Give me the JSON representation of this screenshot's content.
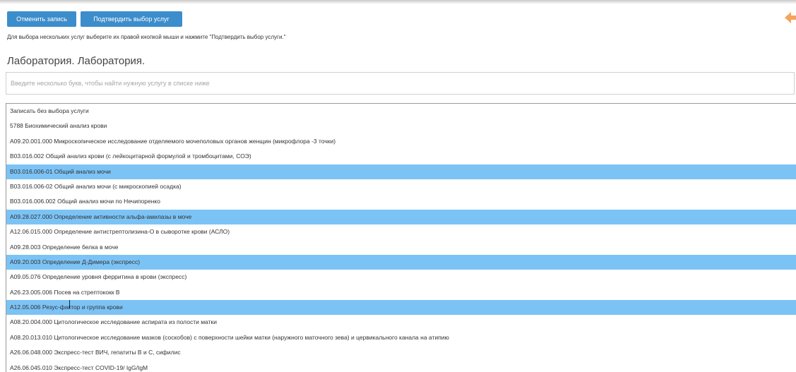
{
  "toolbar": {
    "cancel_label": "Отменить запись",
    "confirm_label": "Подтвердить выбор услуг"
  },
  "hint": "Для выбора нескольких услуг выберите их правой кнопкой мыши и нажмите \"Подтвердить выбор услуги.\"",
  "section_title": "Лаборатория. Лаборатория.",
  "search": {
    "placeholder": "Введите несколько букв, чтобы найти нужную услугу в списке ниже",
    "value": ""
  },
  "colors": {
    "button": "#3c8dcb",
    "selected_row": "#7cc3f5",
    "back_arrow": "#f5a45d"
  },
  "icons": {
    "back": "arrow-left-icon"
  },
  "services": [
    {
      "label": "Записать без выбора услуги",
      "selected": false
    },
    {
      "label": "5788 Биохимический анализ крови",
      "selected": false
    },
    {
      "label": "A09.20.001.000 Микроскопическое исследование отделяемого мочеполовых органов женщин (микрофлора -3 точки)",
      "selected": false
    },
    {
      "label": "B03.016.002 Общий анализ крови (с лейкоцитарной формулой и тромбоцитами, СОЭ)",
      "selected": false
    },
    {
      "label": "B03.016.006-01 Общий анализ мочи",
      "selected": true
    },
    {
      "label": "B03.016.006-02 Общий анализ мочи (с микроскопией осадка)",
      "selected": false
    },
    {
      "label": "B03.016.006.002 Общий анализ мочи по Нечипоренко",
      "selected": false
    },
    {
      "label": "A09.28.027.000 Определение активности альфа-амилазы в моче",
      "selected": true
    },
    {
      "label": "A12.06.015.000 Определение антистрептолизина-О в сыворотке крови (АСЛО)",
      "selected": false
    },
    {
      "label": "A09.28.003 Определение белка в моче",
      "selected": false
    },
    {
      "label": "A09.20.003 Определение Д-Димера (экспресс)",
      "selected": true
    },
    {
      "label": "A09.05.076 Определение уровня ферритина в крови (экспресс)",
      "selected": false
    },
    {
      "label": "A26.23.005.006 Посев на стрептококк В",
      "selected": false
    },
    {
      "label": "A12.05.006 Резус-фактор и группа крови",
      "selected": true
    },
    {
      "label": "A08.20.004.000 Цитологическое исследование аспирата из полости матки",
      "selected": false
    },
    {
      "label": "A08.20.013.010 Цитологическое исследование мазков (соскобов) с поверхности шейки матки (наружного маточного зева) и цервикального канала на атипию",
      "selected": false
    },
    {
      "label": "A26.06.048.000 Экспресс-тест ВИЧ, гепатиты В и С, сифилис",
      "selected": false
    },
    {
      "label": "A26.06.045.010 Экспресс-тест COVID-19/ IgG/IgM",
      "selected": false
    }
  ]
}
